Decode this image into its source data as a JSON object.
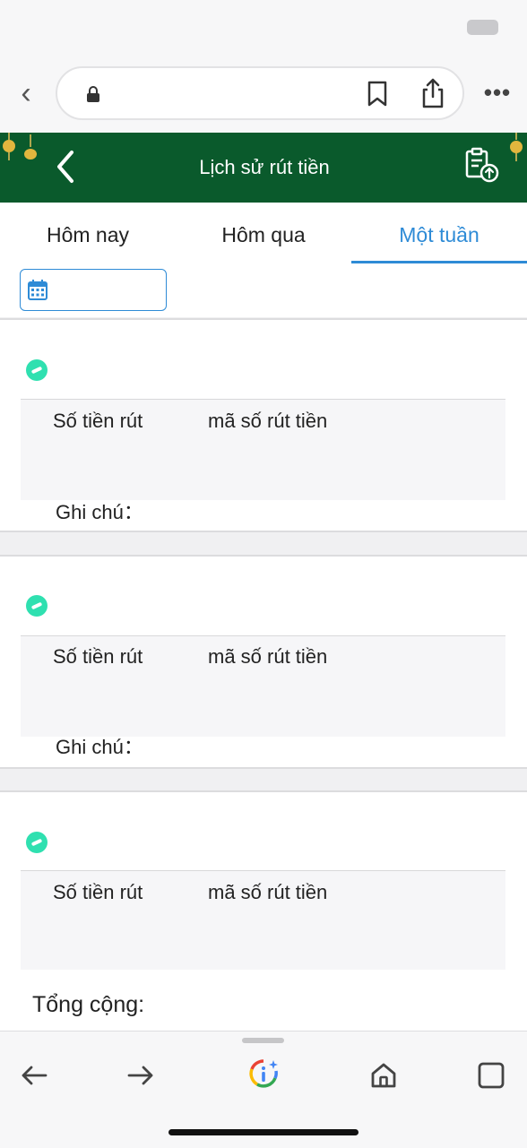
{
  "header": {
    "title": "Lịch sử rút tiền"
  },
  "tabs": [
    {
      "label": "Hôm nay",
      "active": false
    },
    {
      "label": "Hôm qua",
      "active": false
    },
    {
      "label": "Một tuần",
      "active": true
    }
  ],
  "colors": {
    "header_bg": "#0a5a2c",
    "accent": "#2e8bd6",
    "status_icon": "#2fe0b0"
  },
  "records": [
    {
      "amount_label": "Số tiền rút",
      "code_label": "mã số rút tiền",
      "note_label": "Ghi chú："
    },
    {
      "amount_label": "Số tiền rút",
      "code_label": "mã số rút tiền",
      "note_label": "Ghi chú："
    },
    {
      "amount_label": "Số tiền rút",
      "code_label": "mã số rút tiền"
    }
  ],
  "footer": {
    "total_label": "Tổng cộng:"
  }
}
